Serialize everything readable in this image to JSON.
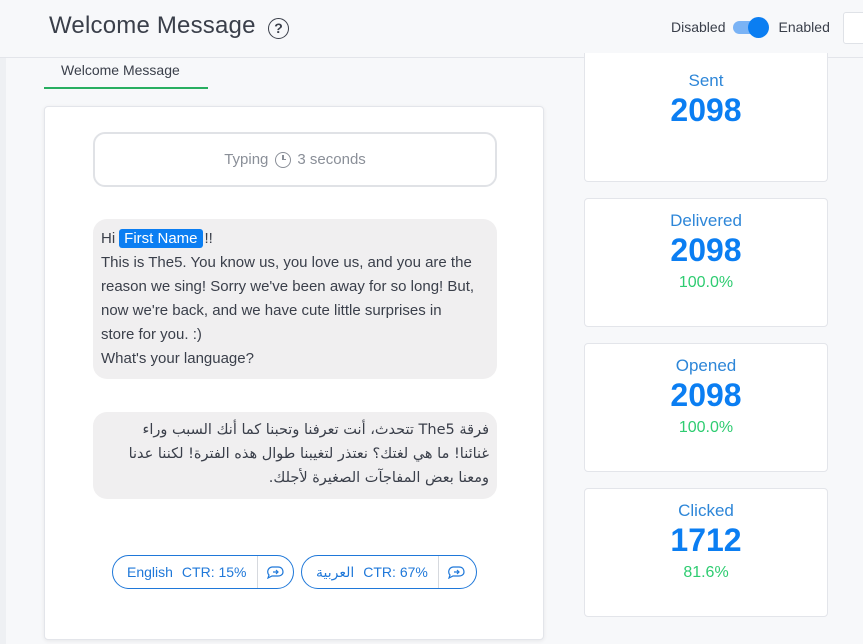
{
  "header": {
    "title": "Welcome Message",
    "help_icon": "question-circle-icon",
    "toggle": {
      "off_label": "Disabled",
      "on_label": "Enabled",
      "state": "enabled"
    }
  },
  "tabs": [
    {
      "label": "Welcome Message",
      "active": true
    }
  ],
  "preview": {
    "typing": {
      "label": "Typing",
      "icon": "clock-icon",
      "duration": "3 seconds"
    },
    "message_en": {
      "greeting": "Hi",
      "placeholder_tag": "First Name",
      "greeting_suffix": "!!",
      "lines": [
        "This is The5. You know us, you love us, and you are the",
        "reason we sing! Sorry we've been away for so long! But,",
        "now we're back, and we have cute little surprises in",
        "store for you. :)",
        "What's your language?"
      ]
    },
    "message_ar": {
      "lines": [
        "فرقة The5 تتحدث، أنت تعرفنا وتحبنا كما أنك السبب وراء",
        "غنائنا! ما هي لغتك؟ نعتذر لتغيبنا طوال هذه الفترة! لكننا عدنا",
        "ومعنا بعض المفاجآت الصغيرة لأجلك."
      ]
    },
    "buttons": [
      {
        "label": "English",
        "ctr": "CTR: 15%",
        "icon": "reply-bubble-icon"
      },
      {
        "label": "العربية",
        "ctr": "CTR: 67%",
        "icon": "reply-bubble-icon"
      }
    ]
  },
  "stats": [
    {
      "label": "Sent",
      "value": "2098",
      "percent": ""
    },
    {
      "label": "Delivered",
      "value": "2098",
      "percent": "100.0%"
    },
    {
      "label": "Opened",
      "value": "2098",
      "percent": "100.0%"
    },
    {
      "label": "Clicked",
      "value": "1712",
      "percent": "81.6%"
    }
  ],
  "colors": {
    "accent": "#0b7ef2",
    "success": "#2ecc71",
    "tab_underline": "#27ae60",
    "bubble": "#f0eff0"
  }
}
